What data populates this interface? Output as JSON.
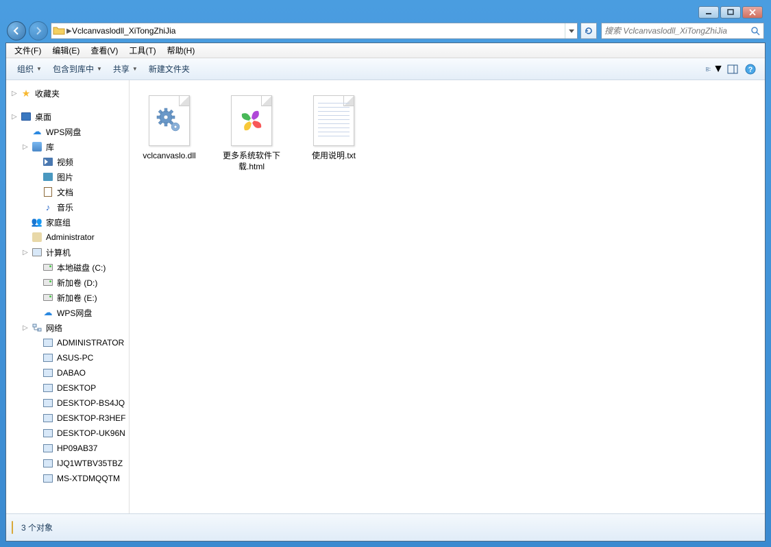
{
  "titlebar": {},
  "nav": {
    "path_sep": "▶",
    "folder_name": "Vclcanvaslodll_XiTongZhiJia",
    "search_placeholder": "搜索 Vclcanvaslodll_XiTongZhiJia"
  },
  "menu": {
    "file": "文件(F)",
    "edit": "编辑(E)",
    "view": "查看(V)",
    "tools": "工具(T)",
    "help": "帮助(H)"
  },
  "toolbar": {
    "organize": "组织",
    "include": "包含到库中",
    "share": "共享",
    "newfolder": "新建文件夹"
  },
  "sidebar": {
    "favorites": "收藏夹",
    "desktop": "桌面",
    "wps": "WPS网盘",
    "libraries": "库",
    "videos": "视频",
    "pictures": "图片",
    "documents": "文档",
    "music": "音乐",
    "homegroup": "家庭组",
    "admin": "Administrator",
    "computer": "计算机",
    "drive_c": "本地磁盘 (C:)",
    "drive_d": "新加卷 (D:)",
    "drive_e": "新加卷 (E:)",
    "wps2": "WPS网盘",
    "network": "网络",
    "net": {
      "n0": "ADMINISTRATOR",
      "n1": "ASUS-PC",
      "n2": "DABAO",
      "n3": "DESKTOP",
      "n4": "DESKTOP-BS4JQ",
      "n5": "DESKTOP-R3HEF",
      "n6": "DESKTOP-UK96N",
      "n7": "HP09AB37",
      "n8": "IJQ1WTBV35TBZ",
      "n9": "MS-XTDMQQTM"
    }
  },
  "files": {
    "f0": "vclcanvaslo.dll",
    "f1": "更多系统软件下载.html",
    "f2": "使用说明.txt"
  },
  "status": {
    "count": "3 个对象"
  }
}
